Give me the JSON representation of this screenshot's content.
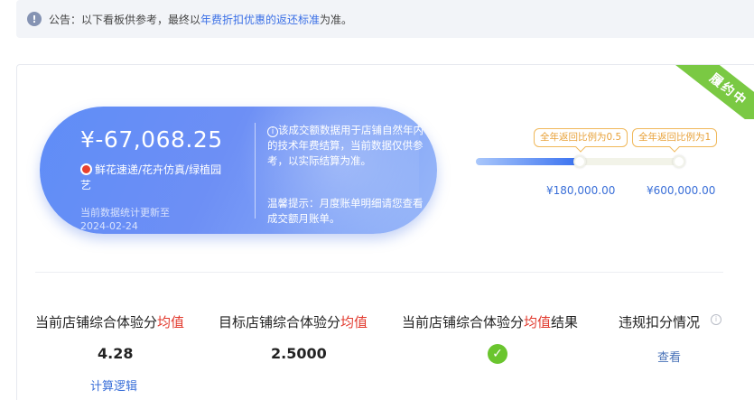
{
  "notice": {
    "prefix": "公告：以下看板供参考，最终以",
    "link": "年费折扣优惠的返还标准",
    "suffix": "为准。"
  },
  "status_ribbon": "履约中",
  "summary": {
    "amount": "¥-67,068.25",
    "shop_name": "鲜花速递/花卉仿真/绿植园艺",
    "update_label": "当前数据统计更新至",
    "update_date": "2024-02-24",
    "description": "该成交额数据用于店铺自然年内的技术年费结算，当前数据仅供参考，以实际结算为准。",
    "tip": "温馨提示：月度账单明细请您查看成交额月账单。"
  },
  "progress": {
    "fill_fraction": 0.5,
    "milestones": [
      {
        "tag": "全年返回比例为0.5",
        "amount": "¥180,000.00"
      },
      {
        "tag": "全年返回比例为1",
        "amount": "¥600,000.00"
      }
    ]
  },
  "metrics": [
    {
      "label_prefix": "当前店铺综合体验分",
      "label_red": "均值",
      "label_suffix": "",
      "value": "4.28",
      "link": "计算逻辑"
    },
    {
      "label_prefix": "目标店铺综合体验分",
      "label_red": "均值",
      "label_suffix": "",
      "value": "2.5000"
    },
    {
      "label_prefix": "当前店铺综合体验分",
      "label_red": "均值",
      "label_suffix": "结果",
      "result_icon": "check-icon"
    },
    {
      "label_prefix": "违规扣分情况",
      "link": "查看"
    }
  ],
  "colors": {
    "accent": "#3a6fd8",
    "ribbon": "#7ac943",
    "tag": "#e8a23a",
    "highlight": "#e23a2e",
    "success": "#6ac52e"
  }
}
